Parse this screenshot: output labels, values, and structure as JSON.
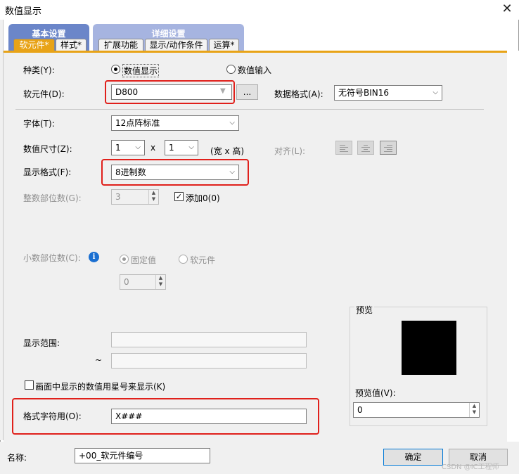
{
  "window": {
    "title": "数值显示",
    "close_glyph": "✕"
  },
  "tabs": {
    "basic": "基本设置",
    "detail": "详细设置",
    "sub": [
      "软元件*",
      "样式*",
      "扩展功能",
      "显示/动作条件",
      "运算*"
    ]
  },
  "form": {
    "kind_label": "种类(Y):",
    "kind_options": [
      "数值显示",
      "数值输入"
    ],
    "device_label": "软元件(D):",
    "device_value": "D800",
    "browse_label": "...",
    "data_format_label": "数据格式(A):",
    "data_format_value": "无符号BIN16",
    "font_label": "字体(T):",
    "font_value": "12点阵标准",
    "size_label": "数值尺寸(Z):",
    "size_w": "1",
    "size_x": "x",
    "size_h": "1",
    "size_unit": "(宽 x 高)",
    "align_label": "对齐(L):",
    "display_format_label": "显示格式(F):",
    "display_format_value": "8进制数",
    "int_digits_label": "整数部位数(G):",
    "int_digits_value": "3",
    "add_zero_label": "添加0(0)",
    "add_zero_checked": "✓",
    "decimal_label": "小数部位数(C):",
    "info_glyph": "i",
    "decimal_options": [
      "固定值",
      "软元件"
    ],
    "decimal_value": "0",
    "range_label": "显示范围:",
    "range_tilde": "~",
    "range_from": "",
    "range_to": "",
    "asterisk_label": "画面中显示的数值用星号来显示(K)",
    "format_string_label": "格式字符用(O):",
    "format_string_value": "X###"
  },
  "preview": {
    "label": "预览",
    "value_label": "预览值(V):",
    "value": "0"
  },
  "footer": {
    "name_label": "名称:",
    "name_value": "+00_软元件编号",
    "ok": "确定",
    "cancel": "取消"
  },
  "watermark": "CSDN @IC工程师",
  "colors": {
    "accent": "#e8a317",
    "tab_basic": "#6b86c9",
    "tab_detail": "#a6b4e0",
    "highlight": "#e0201b"
  }
}
